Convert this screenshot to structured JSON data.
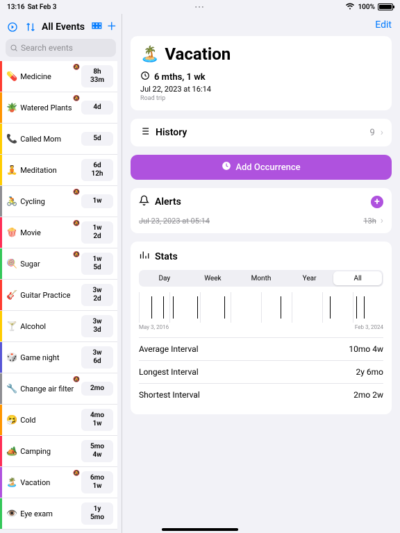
{
  "statusbar": {
    "time": "13:16",
    "date": "Sat Feb 3",
    "battery": "100%"
  },
  "sidebar": {
    "filter_title": "All Events",
    "search_placeholder": "Search events",
    "events": [
      {
        "emoji": "💊",
        "label": "Medicine",
        "time": "8h\n33m",
        "color": "#ff3b30",
        "pinned": true
      },
      {
        "emoji": "🪴",
        "label": "Watered Plants",
        "time": "4d",
        "color": "#ff9500",
        "pinned": true
      },
      {
        "emoji": "📞",
        "label": "Called Mom",
        "time": "5d",
        "color": "#ffcc00",
        "pinned": false
      },
      {
        "emoji": "🧘",
        "label": "Meditation",
        "time": "6d\n12h",
        "color": "#ffcc00",
        "pinned": false
      },
      {
        "emoji": "🚴",
        "label": "Cycling",
        "time": "1w",
        "color": "#8e8e93",
        "pinned": true
      },
      {
        "emoji": "🍿",
        "label": "Movie",
        "time": "1w\n2d",
        "color": "#ff2d55",
        "pinned": true
      },
      {
        "emoji": "🍭",
        "label": "Sugar",
        "time": "1w\n5d",
        "color": "#34c759",
        "pinned": true
      },
      {
        "emoji": "🎸",
        "label": "Guitar Practice",
        "time": "3w\n2d",
        "color": "#ff3b30",
        "pinned": false
      },
      {
        "emoji": "🍸",
        "label": "Alcohol",
        "time": "3w\n3d",
        "color": "#ffcc00",
        "pinned": false
      },
      {
        "emoji": "🎲",
        "label": "Game night",
        "time": "3w\n6d",
        "color": "#5856d6",
        "pinned": false
      },
      {
        "emoji": "🔧",
        "label": "Change air filter",
        "time": "2mo",
        "color": "#8e8e93",
        "pinned": true
      },
      {
        "emoji": "🤧",
        "label": "Cold",
        "time": "4mo\n1w",
        "color": "#ff9500",
        "pinned": false
      },
      {
        "emoji": "🏕️",
        "label": "Camping",
        "time": "5mo\n4w",
        "color": "#ff2d55",
        "pinned": false
      },
      {
        "emoji": "🏝️",
        "label": "Vacation",
        "time": "6mo\n1w",
        "color": "#af52de",
        "pinned": true
      },
      {
        "emoji": "👁️",
        "label": "Eye exam",
        "time": "1y\n5mo",
        "color": "#34c759",
        "pinned": false
      }
    ]
  },
  "detail": {
    "edit": "Edit",
    "emoji": "🏝️",
    "title": "Vacation",
    "elapsed": "6 mths, 1 wk",
    "last_date": "Jul 22, 2023 at 16:14",
    "notes": "Road trip",
    "history": {
      "label": "History",
      "count": "9"
    },
    "add_label": "Add Occurrence",
    "alerts": {
      "label": "Alerts",
      "items": [
        {
          "when": "Jul 23, 2023 at 05:14",
          "rel": "13h"
        }
      ]
    },
    "stats": {
      "label": "Stats",
      "tabs": [
        "Day",
        "Week",
        "Month",
        "Year",
        "All"
      ],
      "active_tab": 4,
      "range_start": "May 3, 2016",
      "range_end": "Feb 3, 2024",
      "marks": [
        5,
        10,
        14,
        24,
        35,
        58,
        78,
        89,
        92
      ],
      "rows": [
        {
          "k": "Average Interval",
          "v": "10mo 4w"
        },
        {
          "k": "Longest Interval",
          "v": "2y 6mo"
        },
        {
          "k": "Shortest Interval",
          "v": "2mo 2w"
        }
      ]
    }
  }
}
